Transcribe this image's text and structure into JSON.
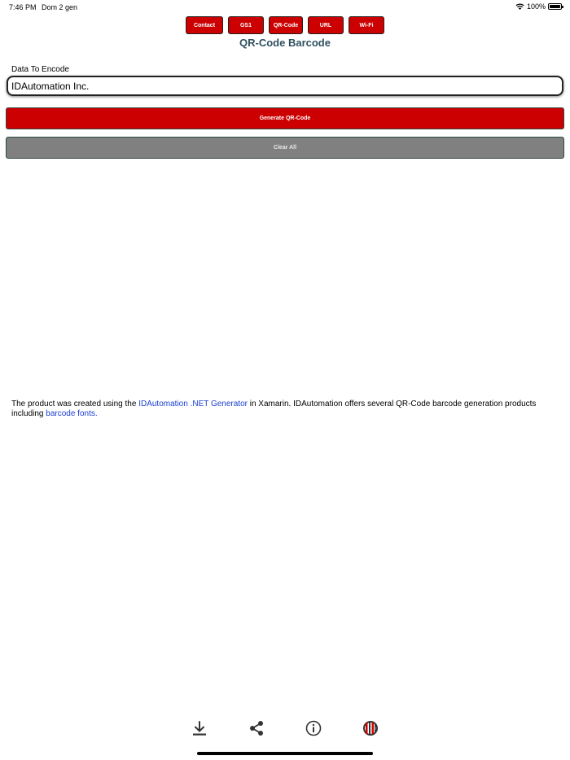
{
  "status_bar": {
    "time": "7:46 PM",
    "date": "Dom 2 gen",
    "battery": "100%",
    "wifi_icon": "wifi-icon",
    "battery_icon": "battery-icon"
  },
  "tabs": [
    {
      "label": "Contact"
    },
    {
      "label": "GS1"
    },
    {
      "label": "QR-Code"
    },
    {
      "label": "URL"
    },
    {
      "label": "Wi-Fi"
    }
  ],
  "page_title": "QR-Code Barcode",
  "form": {
    "label": "Data To Encode",
    "value": "IDAutomation Inc."
  },
  "buttons": {
    "generate": "Generate QR-Code",
    "clear": "Clear All"
  },
  "info": {
    "part1": "The product was created using the ",
    "link1": "IDAutomation .NET Generator",
    "part2": " in Xamarin. IDAutomation offers several QR-Code barcode generation products including ",
    "link2": "barcode fonts."
  },
  "toolbar": {
    "icons": [
      "download-icon",
      "share-icon",
      "info-icon",
      "idautomation-logo-icon"
    ]
  },
  "colors": {
    "accent_red": "#cc0000",
    "clear_gray": "#808080",
    "title_color": "#2f5060",
    "link_blue": "#1a3fd1"
  }
}
